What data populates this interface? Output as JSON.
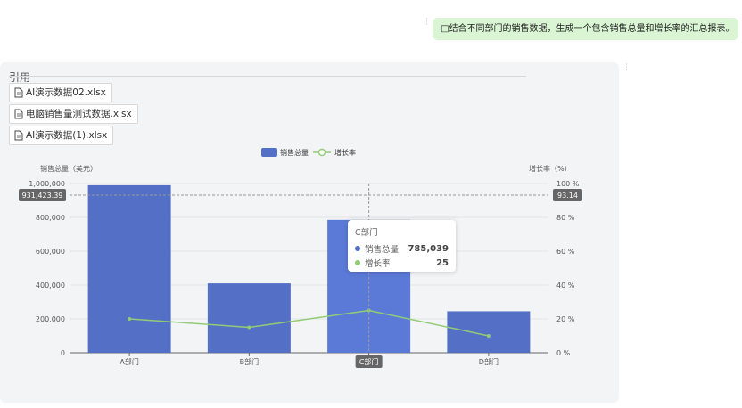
{
  "user_message": {
    "text": "□结合不同部门的销售数据，生成一个包含销售总量和增长率的汇总报表。"
  },
  "reply": {
    "reference_title": "引用",
    "files": [
      {
        "name": "AI演示数据02.xlsx"
      },
      {
        "name": "电脑销售量测试数据.xlsx"
      },
      {
        "name": "AI演示数据(1).xlsx"
      }
    ]
  },
  "colors": {
    "bar": "#5470c6",
    "line": "#91cc75",
    "user_bubble": "#d9f5d3",
    "card": "#f3f4f6"
  },
  "chart_data": {
    "type": "bar",
    "categories": [
      "A部门",
      "B部门",
      "C部门",
      "D部门"
    ],
    "series": [
      {
        "name": "销售总量",
        "type": "bar",
        "values": [
          990000,
          410000,
          785039,
          245000
        ]
      },
      {
        "name": "增长率",
        "type": "line",
        "values": [
          20,
          15,
          25,
          10
        ]
      }
    ],
    "ylabel": "销售总量（美元）",
    "ylabel_right": "增长率（%）",
    "ylim": [
      0,
      1000000
    ],
    "ylim_right": [
      0,
      100
    ],
    "yticks": [
      "0",
      "200,000",
      "400,000",
      "600,000",
      "800,000",
      "1,000,000"
    ],
    "yticks_right": [
      "0 %",
      "20 %",
      "40 %",
      "60 %",
      "80 %",
      "100 %"
    ],
    "grid": true,
    "legend": "top-center",
    "crosshair": {
      "left_value": "931,423.39",
      "right_value": "93.14",
      "category": "C部门"
    },
    "tooltip": {
      "title": "C部门",
      "rows": [
        {
          "name": "销售总量",
          "value": "785,039"
        },
        {
          "name": "增长率",
          "value": "25"
        }
      ]
    }
  }
}
